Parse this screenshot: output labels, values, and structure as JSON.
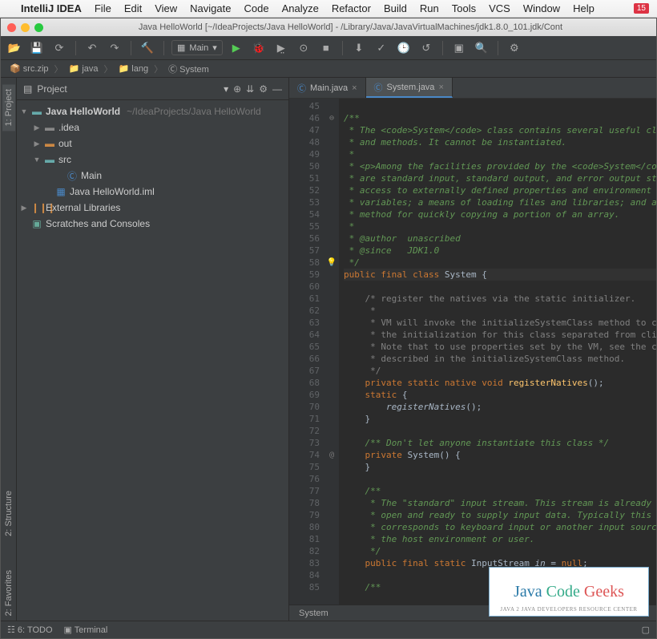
{
  "menubar": {
    "apple": "",
    "appname": "IntelliJ IDEA",
    "items": [
      "File",
      "Edit",
      "View",
      "Navigate",
      "Code",
      "Analyze",
      "Refactor",
      "Build",
      "Run",
      "Tools",
      "VCS",
      "Window",
      "Help"
    ],
    "badge": "15"
  },
  "window": {
    "title": "Java HelloWorld [~/IdeaProjects/Java HelloWorld] - /Library/Java/JavaVirtualMachines/jdk1.8.0_101.jdk/Cont"
  },
  "toolbar": {
    "runconfig": "Main"
  },
  "breadcrumb": {
    "items": [
      "src.zip",
      "java",
      "lang",
      "System"
    ]
  },
  "leftTabs": [
    "1: Project",
    "2: Structure",
    "2: Favorites"
  ],
  "projectPanel": {
    "title": "Project"
  },
  "tree": {
    "root": {
      "label": "Java HelloWorld",
      "path": "~/IdeaProjects/Java HelloWorld"
    },
    "idea": ".idea",
    "out": "out",
    "src": "src",
    "main": "Main",
    "iml": "Java HelloWorld.iml",
    "ext": "External Libraries",
    "scratch": "Scratches and Consoles"
  },
  "tabs": [
    {
      "label": "Main.java",
      "active": false
    },
    {
      "label": "System.java",
      "active": true
    }
  ],
  "lines": [
    {
      "n": 45,
      "t": ""
    },
    {
      "n": 46,
      "t": "/**",
      "cls": "c-doc",
      "marg": "⊖"
    },
    {
      "n": 47,
      "t": " * The <code>System</code> class contains several useful clas",
      "cls": "c-doc"
    },
    {
      "n": 48,
      "t": " * and methods. It cannot be instantiated.",
      "cls": "c-doc"
    },
    {
      "n": 49,
      "t": " *",
      "cls": "c-doc"
    },
    {
      "n": 50,
      "t": " * <p>Among the facilities provided by the <code>System</code",
      "cls": "c-doc"
    },
    {
      "n": 51,
      "t": " * are standard input, standard output, and error output stre",
      "cls": "c-doc"
    },
    {
      "n": 52,
      "t": " * access to externally defined properties and environment",
      "cls": "c-doc"
    },
    {
      "n": 53,
      "t": " * variables; a means of loading files and libraries; and a u",
      "cls": "c-doc"
    },
    {
      "n": 54,
      "t": " * method for quickly copying a portion of an array.",
      "cls": "c-doc"
    },
    {
      "n": 55,
      "t": " *",
      "cls": "c-doc"
    },
    {
      "n": 56,
      "t": " * @author  unascribed",
      "cls": "c-doc"
    },
    {
      "n": 57,
      "t": " * @since   JDK1.0",
      "cls": "c-doc"
    },
    {
      "n": 58,
      "t": " */",
      "cls": "c-doc",
      "marg": "💡"
    },
    {
      "n": 59,
      "t": "public final class System {",
      "cls": "c-currline",
      "kw": true
    },
    {
      "n": 60,
      "t": ""
    },
    {
      "n": 61,
      "t": "    /* register the natives via the static initializer.",
      "cls": "c-cmt"
    },
    {
      "n": 62,
      "t": "     *",
      "cls": "c-cmt"
    },
    {
      "n": 63,
      "t": "     * VM will invoke the initializeSystemClass method to com",
      "cls": "c-cmt"
    },
    {
      "n": 64,
      "t": "     * the initialization for this class separated from clini",
      "cls": "c-cmt"
    },
    {
      "n": 65,
      "t": "     * Note that to use properties set by the VM, see the con",
      "cls": "c-cmt"
    },
    {
      "n": 66,
      "t": "     * described in the initializeSystemClass method.",
      "cls": "c-cmt"
    },
    {
      "n": 67,
      "t": "     */",
      "cls": "c-cmt"
    },
    {
      "n": 68,
      "t": "    private static native void registerNatives();",
      "kw": true
    },
    {
      "n": 69,
      "t": "    static {",
      "kw": true
    },
    {
      "n": 70,
      "t": "        registerNatives();",
      "ital": true
    },
    {
      "n": 71,
      "t": "    }"
    },
    {
      "n": 72,
      "t": ""
    },
    {
      "n": 73,
      "t": "    /** Don't let anyone instantiate this class */",
      "cls": "c-doc"
    },
    {
      "n": 74,
      "t": "    private System() {",
      "kw": true,
      "marg": "@"
    },
    {
      "n": 75,
      "t": "    }"
    },
    {
      "n": 76,
      "t": ""
    },
    {
      "n": 77,
      "t": "    /**",
      "cls": "c-doc"
    },
    {
      "n": 78,
      "t": "     * The \"standard\" input stream. This stream is already",
      "cls": "c-doc"
    },
    {
      "n": 79,
      "t": "     * open and ready to supply input data. Typically this st",
      "cls": "c-doc"
    },
    {
      "n": 80,
      "t": "     * corresponds to keyboard input or another input source ",
      "cls": "c-doc"
    },
    {
      "n": 81,
      "t": "     * the host environment or user.",
      "cls": "c-doc"
    },
    {
      "n": 82,
      "t": "     */",
      "cls": "c-doc"
    },
    {
      "n": 83,
      "t": "    public final static InputStream in = null;",
      "kw": true
    },
    {
      "n": 84,
      "t": ""
    },
    {
      "n": 85,
      "t": "    /**",
      "cls": "c-doc"
    }
  ],
  "editorStatus": "System",
  "statusbar": {
    "todo": "6: TODO",
    "terminal": "Terminal"
  },
  "watermark": {
    "t1": "Java ",
    "t2": "Code ",
    "t3": "Geeks",
    "sub": "JAVA 2 JAVA DEVELOPERS RESOURCE CENTER"
  }
}
